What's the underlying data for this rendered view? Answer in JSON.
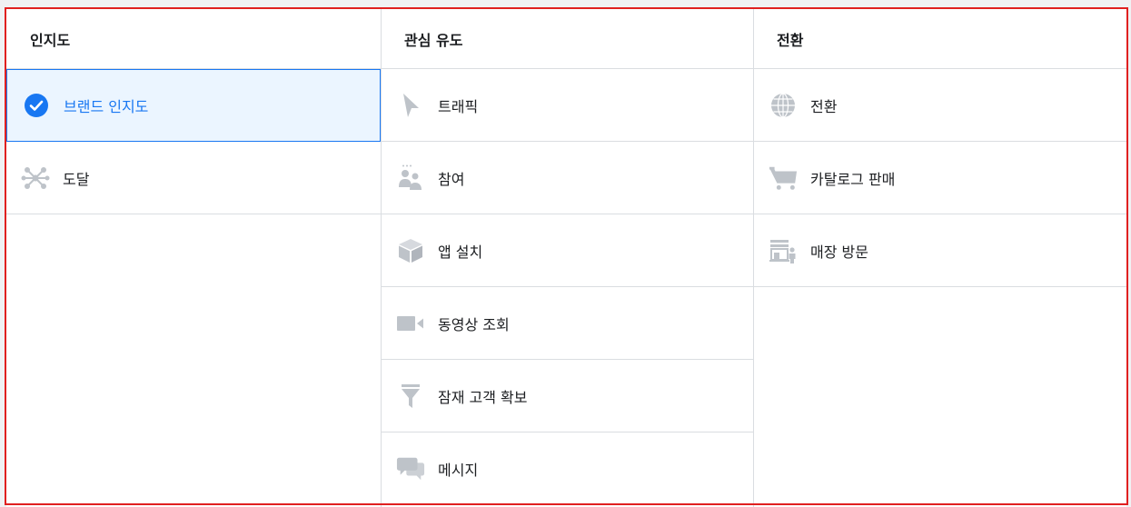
{
  "columns": [
    {
      "header": "인지도",
      "options": [
        {
          "label": "브랜드 인지도",
          "icon": "check-circle-icon",
          "selected": true
        },
        {
          "label": "도달",
          "icon": "network-hub-icon",
          "selected": false
        }
      ]
    },
    {
      "header": "관심 유도",
      "options": [
        {
          "label": "트래픽",
          "icon": "cursor-pointer-icon",
          "selected": false
        },
        {
          "label": "참여",
          "icon": "people-icon",
          "selected": false
        },
        {
          "label": "앱 설치",
          "icon": "box-icon",
          "selected": false
        },
        {
          "label": "동영상 조회",
          "icon": "video-camera-icon",
          "selected": false
        },
        {
          "label": "잠재 고객 확보",
          "icon": "funnel-icon",
          "selected": false
        },
        {
          "label": "메시지",
          "icon": "chat-bubbles-icon",
          "selected": false
        }
      ]
    },
    {
      "header": "전환",
      "options": [
        {
          "label": "전환",
          "icon": "globe-icon",
          "selected": false
        },
        {
          "label": "카탈로그 판매",
          "icon": "shopping-cart-icon",
          "selected": false
        },
        {
          "label": "매장 방문",
          "icon": "store-person-icon",
          "selected": false
        }
      ]
    }
  ],
  "colors": {
    "selected_accent": "#1877f2",
    "selected_background": "#ebf5ff",
    "icon_gray": "#bec3c9",
    "divider": "#dadde1",
    "highlight_frame": "#e02020"
  }
}
